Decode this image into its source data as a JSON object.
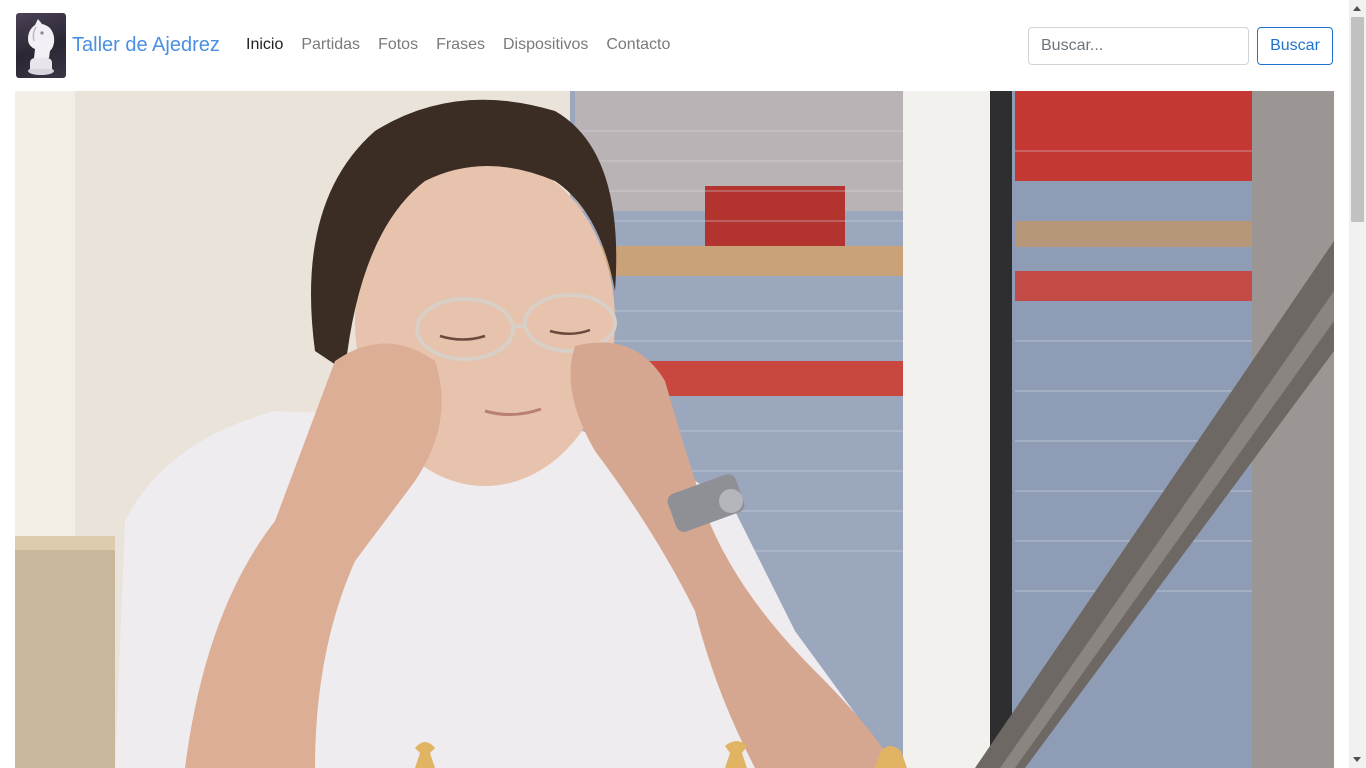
{
  "navbar": {
    "brand_name": "Taller de Ajedrez",
    "logo_icon": "chess-knight-icon",
    "links": [
      {
        "label": "Inicio",
        "active": true
      },
      {
        "label": "Partidas",
        "active": false
      },
      {
        "label": "Fotos",
        "active": false
      },
      {
        "label": "Frases",
        "active": false
      },
      {
        "label": "Dispositivos",
        "active": false
      },
      {
        "label": "Contacto",
        "active": false
      }
    ],
    "search": {
      "placeholder": "Buscar...",
      "value": "",
      "button_label": "Buscar"
    }
  },
  "colors": {
    "brand": "#4a90e2",
    "active_link": "#222222",
    "link": "#7a7a7a",
    "button_outline": "#1f73d0"
  }
}
